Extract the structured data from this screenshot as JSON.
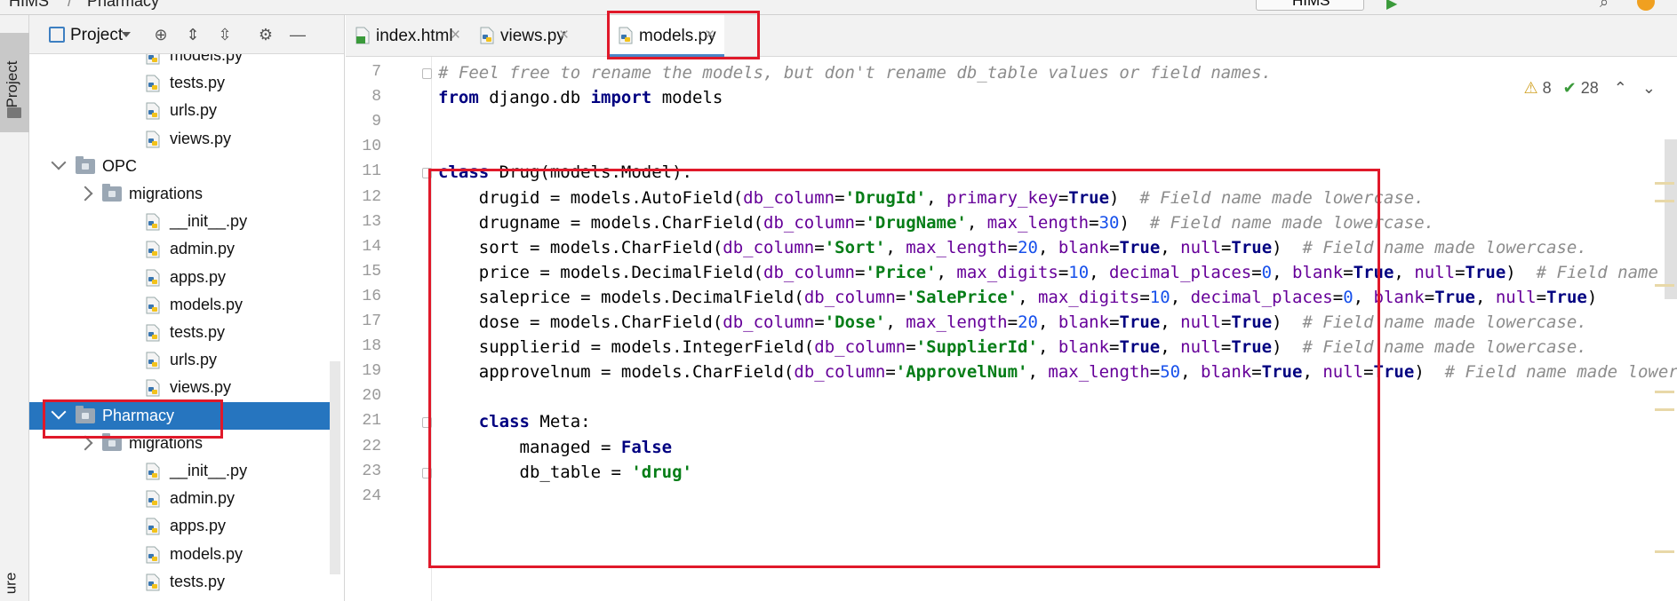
{
  "window": {
    "breadcrumb_left": "HIMS",
    "breadcrumb_sep": "/",
    "breadcrumb_right": "Pharmacy",
    "run_config": "HIMS"
  },
  "sidestrip": {
    "project_label": "Project",
    "bottom_label": "ure"
  },
  "project_panel": {
    "title": "Project"
  },
  "tree": [
    {
      "label": "models.py",
      "type": "file"
    },
    {
      "label": "tests.py",
      "type": "file"
    },
    {
      "label": "urls.py",
      "type": "file"
    },
    {
      "label": "views.py",
      "type": "file"
    },
    {
      "label": "OPC",
      "type": "folder-open"
    },
    {
      "label": "migrations",
      "type": "folder-closed"
    },
    {
      "label": "__init__.py",
      "type": "file"
    },
    {
      "label": "admin.py",
      "type": "file"
    },
    {
      "label": "apps.py",
      "type": "file"
    },
    {
      "label": "models.py",
      "type": "file"
    },
    {
      "label": "tests.py",
      "type": "file"
    },
    {
      "label": "urls.py",
      "type": "file"
    },
    {
      "label": "views.py",
      "type": "file"
    },
    {
      "label": "Pharmacy",
      "type": "folder-open",
      "selected": true
    },
    {
      "label": "migrations",
      "type": "folder-closed"
    },
    {
      "label": "__init__.py",
      "type": "file"
    },
    {
      "label": "admin.py",
      "type": "file"
    },
    {
      "label": "apps.py",
      "type": "file"
    },
    {
      "label": "models.py",
      "type": "file"
    },
    {
      "label": "tests.py",
      "type": "file"
    }
  ],
  "tabs": [
    {
      "label": "index.html",
      "icon": "html-file-icon"
    },
    {
      "label": "views.py",
      "icon": "python-file-icon"
    },
    {
      "label": "models.py",
      "icon": "python-file-icon",
      "active": true
    }
  ],
  "inspections": {
    "warnings": "8",
    "weak_warnings": "28"
  },
  "line_numbers": [
    "7",
    "8",
    "9",
    "10",
    "11",
    "12",
    "13",
    "14",
    "15",
    "16",
    "17",
    "18",
    "19",
    "20",
    "21",
    "22",
    "23",
    "24"
  ],
  "code": [
    [
      [
        "com",
        "# Feel free to rename the models, but don't rename db_table values or field names."
      ]
    ],
    [
      [
        "kw",
        "from"
      ],
      [
        "t",
        " django.db "
      ],
      [
        "kw",
        "import"
      ],
      [
        "t",
        " models"
      ]
    ],
    [],
    [],
    [
      [
        "kw",
        "class"
      ],
      [
        "t",
        " Drug(models.Model):"
      ]
    ],
    [
      [
        "t",
        "    drugid = models.AutoField("
      ],
      [
        "param",
        "db_column"
      ],
      [
        "t",
        "="
      ],
      [
        "str",
        "'DrugId'"
      ],
      [
        "t",
        ", "
      ],
      [
        "param",
        "primary_key"
      ],
      [
        "t",
        "="
      ],
      [
        "kw",
        "True"
      ],
      [
        "t",
        ")  "
      ],
      [
        "com",
        "# Field name made lowercase."
      ]
    ],
    [
      [
        "t",
        "    drugname = models.CharField("
      ],
      [
        "param",
        "db_column"
      ],
      [
        "t",
        "="
      ],
      [
        "str",
        "'DrugName'"
      ],
      [
        "t",
        ", "
      ],
      [
        "param",
        "max_length"
      ],
      [
        "t",
        "="
      ],
      [
        "num",
        "30"
      ],
      [
        "t",
        ")  "
      ],
      [
        "com",
        "# Field name made lowercase."
      ]
    ],
    [
      [
        "t",
        "    sort = models.CharField("
      ],
      [
        "param",
        "db_column"
      ],
      [
        "t",
        "="
      ],
      [
        "str",
        "'Sort'"
      ],
      [
        "t",
        ", "
      ],
      [
        "param",
        "max_length"
      ],
      [
        "t",
        "="
      ],
      [
        "num",
        "20"
      ],
      [
        "t",
        ", "
      ],
      [
        "param",
        "blank"
      ],
      [
        "t",
        "="
      ],
      [
        "kw",
        "True"
      ],
      [
        "t",
        ", "
      ],
      [
        "param",
        "null"
      ],
      [
        "t",
        "="
      ],
      [
        "kw",
        "True"
      ],
      [
        "t",
        ")  "
      ],
      [
        "com",
        "# Field name made lowercase."
      ]
    ],
    [
      [
        "t",
        "    price = models.DecimalField("
      ],
      [
        "param",
        "db_column"
      ],
      [
        "t",
        "="
      ],
      [
        "str",
        "'Price'"
      ],
      [
        "t",
        ", "
      ],
      [
        "param",
        "max_digits"
      ],
      [
        "t",
        "="
      ],
      [
        "num",
        "10"
      ],
      [
        "t",
        ", "
      ],
      [
        "param",
        "decimal_places"
      ],
      [
        "t",
        "="
      ],
      [
        "num",
        "0"
      ],
      [
        "t",
        ", "
      ],
      [
        "param",
        "blank"
      ],
      [
        "t",
        "="
      ],
      [
        "kw",
        "True"
      ],
      [
        "t",
        ", "
      ],
      [
        "param",
        "null"
      ],
      [
        "t",
        "="
      ],
      [
        "kw",
        "True"
      ],
      [
        "t",
        ")  "
      ],
      [
        "com",
        "# Field name made lowercase."
      ]
    ],
    [
      [
        "t",
        "    saleprice = models.DecimalField("
      ],
      [
        "param",
        "db_column"
      ],
      [
        "t",
        "="
      ],
      [
        "str",
        "'SalePrice'"
      ],
      [
        "t",
        ", "
      ],
      [
        "param",
        "max_digits"
      ],
      [
        "t",
        "="
      ],
      [
        "num",
        "10"
      ],
      [
        "t",
        ", "
      ],
      [
        "param",
        "decimal_places"
      ],
      [
        "t",
        "="
      ],
      [
        "num",
        "0"
      ],
      [
        "t",
        ", "
      ],
      [
        "param",
        "blank"
      ],
      [
        "t",
        "="
      ],
      [
        "kw",
        "True"
      ],
      [
        "t",
        ", "
      ],
      [
        "param",
        "null"
      ],
      [
        "t",
        "="
      ],
      [
        "kw",
        "True"
      ],
      [
        "t",
        ")"
      ]
    ],
    [
      [
        "t",
        "    dose = models.CharField("
      ],
      [
        "param",
        "db_column"
      ],
      [
        "t",
        "="
      ],
      [
        "str",
        "'Dose'"
      ],
      [
        "t",
        ", "
      ],
      [
        "param",
        "max_length"
      ],
      [
        "t",
        "="
      ],
      [
        "num",
        "20"
      ],
      [
        "t",
        ", "
      ],
      [
        "param",
        "blank"
      ],
      [
        "t",
        "="
      ],
      [
        "kw",
        "True"
      ],
      [
        "t",
        ", "
      ],
      [
        "param",
        "null"
      ],
      [
        "t",
        "="
      ],
      [
        "kw",
        "True"
      ],
      [
        "t",
        ")  "
      ],
      [
        "com",
        "# Field name made lowercase."
      ]
    ],
    [
      [
        "t",
        "    supplierid = models.IntegerField("
      ],
      [
        "param",
        "db_column"
      ],
      [
        "t",
        "="
      ],
      [
        "str",
        "'SupplierId'"
      ],
      [
        "t",
        ", "
      ],
      [
        "param",
        "blank"
      ],
      [
        "t",
        "="
      ],
      [
        "kw",
        "True"
      ],
      [
        "t",
        ", "
      ],
      [
        "param",
        "null"
      ],
      [
        "t",
        "="
      ],
      [
        "kw",
        "True"
      ],
      [
        "t",
        ")  "
      ],
      [
        "com",
        "# Field name made lowercase."
      ]
    ],
    [
      [
        "t",
        "    approvelnum = models.CharField("
      ],
      [
        "param",
        "db_column"
      ],
      [
        "t",
        "="
      ],
      [
        "str",
        "'ApprovelNum'"
      ],
      [
        "t",
        ", "
      ],
      [
        "param",
        "max_length"
      ],
      [
        "t",
        "="
      ],
      [
        "num",
        "50"
      ],
      [
        "t",
        ", "
      ],
      [
        "param",
        "blank"
      ],
      [
        "t",
        "="
      ],
      [
        "kw",
        "True"
      ],
      [
        "t",
        ", "
      ],
      [
        "param",
        "null"
      ],
      [
        "t",
        "="
      ],
      [
        "kw",
        "True"
      ],
      [
        "t",
        ")  "
      ],
      [
        "com",
        "# Field name made lowercase."
      ]
    ],
    [],
    [
      [
        "t",
        "    "
      ],
      [
        "kw",
        "class"
      ],
      [
        "t",
        " Meta:"
      ]
    ],
    [
      [
        "t",
        "        managed = "
      ],
      [
        "kw",
        "False"
      ]
    ],
    [
      [
        "t",
        "        db_table = "
      ],
      [
        "str",
        "'drug'"
      ]
    ],
    []
  ],
  "colors": {
    "selection": "#2675bf",
    "annotation_red": "#e0192a",
    "keyword": "#000080",
    "string": "#067d17",
    "comment": "#8c8c8c",
    "param": "#660099",
    "number": "#1750eb"
  }
}
